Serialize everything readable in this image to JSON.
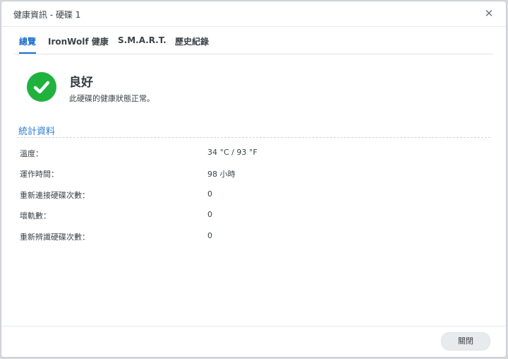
{
  "window": {
    "title": "健康資訊 - 硬碟 1",
    "close_icon": "close-icon"
  },
  "tabs": [
    {
      "label": "總覽",
      "active": true
    },
    {
      "label": "IronWolf 健康",
      "active": false
    },
    {
      "label": "S.M.A.R.T.",
      "active": false
    },
    {
      "label": "歷史紀錄",
      "active": false
    }
  ],
  "status": {
    "icon": "check-circle-icon",
    "color": "#1fb33e",
    "title": "良好",
    "description": "此硬碟的健康狀態正常。"
  },
  "stats": {
    "section_title": "統計資料",
    "rows": [
      {
        "label": "溫度：",
        "value": "34 °C / 93 °F"
      },
      {
        "label": "運作時間：",
        "value": "98 小時"
      },
      {
        "label": "重新連接硬碟次數：",
        "value": "0"
      },
      {
        "label": "壞軌數：",
        "value": "0"
      },
      {
        "label": "重新辨識硬碟次數：",
        "value": "0"
      }
    ]
  },
  "footer": {
    "close_label": "關閉"
  },
  "colors": {
    "accent": "#1f6fd1",
    "section": "#2d7dd6",
    "ok": "#1fb33e"
  }
}
